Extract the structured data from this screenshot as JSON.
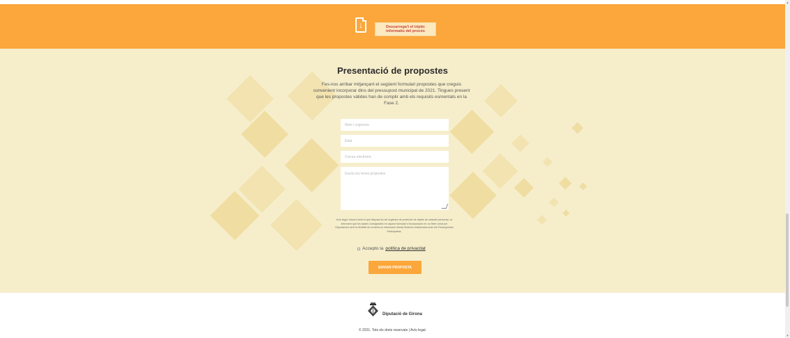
{
  "header": {
    "download_icon": "download-document-icon",
    "download_line_1": "Descarrega't el tríptic",
    "download_line_2": "informatiu del procés"
  },
  "main": {
    "title": "Presentació de propostes",
    "intro": "Fes-nos arribar mitjançant el següent formulari propostes que creguis convenient incorporar dins del pressupost municipal de 2021. Tingues present que les propostes vàlides han de complir amb els requisits esmentats en la Fase 2.",
    "form": {
      "name_placeholder": "Nom i cognoms",
      "age_placeholder": "Edat",
      "email_placeholder": "Correu electrònic",
      "proposals_placeholder": "Escriu les teves propostes"
    },
    "legal_notice": "Avís legal: d'acord amb el que disposa la Llei orgànica de protecció de dades de caràcter personal, us informem que les dades consignades en aquest formulari s'incorporaran en un fitxer creat per l'Ajuntament amb la finalitat de remetre-us informació oficial d'interès relacionada amb els Pressupostos Participatius.",
    "consent_prefix": "Accepto la",
    "consent_link": "política de privacitat",
    "submit_label": "ENVIAR PROPOSTA"
  },
  "footer": {
    "brand": "Diputació de Girona",
    "copyright": "© 2021. Tots els drets reservats | Avís legal."
  },
  "colors": {
    "accent": "#fba73b",
    "background": "#f6eecb",
    "diamond": "#f0dda2"
  }
}
